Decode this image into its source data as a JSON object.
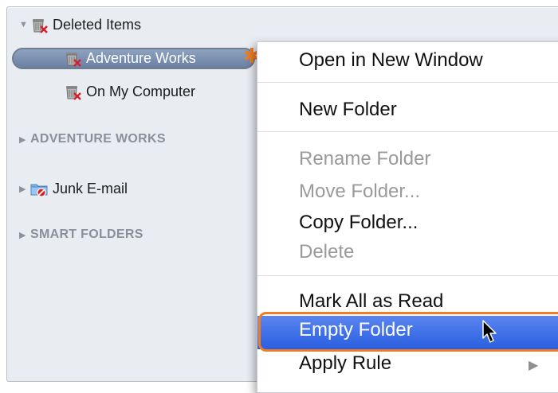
{
  "sidebar": {
    "deleted_items": "Deleted Items",
    "adventure_works_folder": "Adventure Works",
    "on_my_computer": "On My Computer",
    "section_adventure_works": "ADVENTURE WORKS",
    "junk_email": "Junk E-mail",
    "section_smart_folders": "SMART FOLDERS"
  },
  "context_menu": {
    "open_new_window": "Open in New Window",
    "new_folder": "New Folder",
    "rename_folder": "Rename Folder",
    "move_folder": "Move Folder...",
    "copy_folder": "Copy Folder...",
    "delete": "Delete",
    "mark_all_read": "Mark All as Read",
    "empty_folder": "Empty Folder",
    "apply_rule": "Apply Rule"
  },
  "colors": {
    "accent_highlight": "#2a5fe0",
    "callout": "#f07d22",
    "sidebar_bg": "#e9edf2"
  },
  "icons": [
    "disclosure-open-icon",
    "trash-icon",
    "star-icon",
    "disclosure-closed-icon",
    "junk-folder-icon",
    "submenu-arrow-icon",
    "cursor-icon"
  ]
}
